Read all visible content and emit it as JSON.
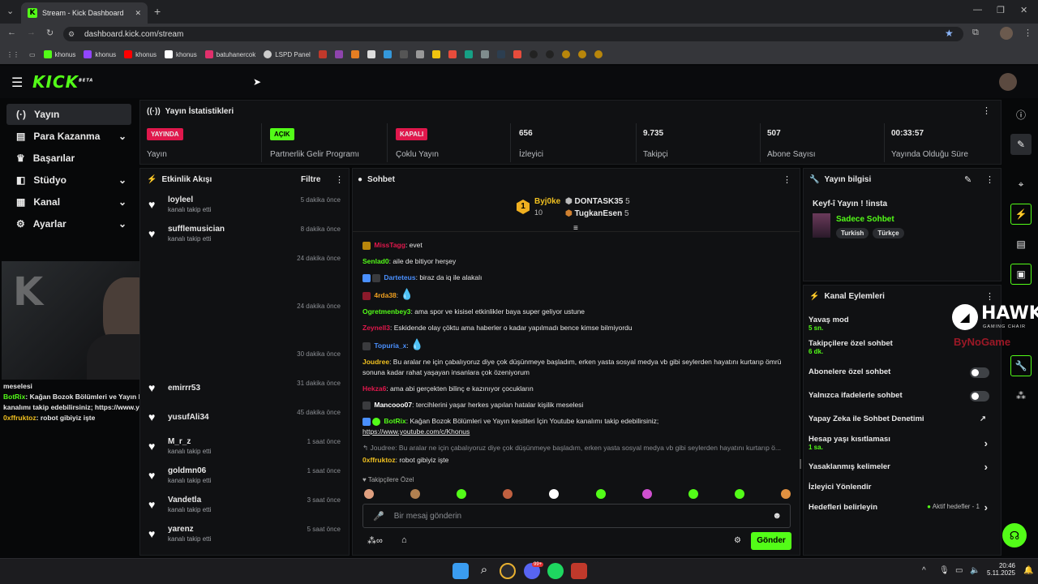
{
  "browser": {
    "tab_title": "Stream - Kick Dashboard",
    "url": "dashboard.kick.com/stream",
    "bookmarks": [
      {
        "label": "khonus",
        "color": "#53fc18"
      },
      {
        "label": "khonus",
        "color": "#9146ff"
      },
      {
        "label": "khonus",
        "color": "#ff0000"
      },
      {
        "label": "khonus",
        "color": "#ffffff"
      },
      {
        "label": "batuhanercok",
        "color": "#e1306c"
      },
      {
        "label": "LSPD Panel",
        "color": "#cccccc"
      }
    ]
  },
  "app": {
    "logo": "KICK",
    "logo_sup": "BETA"
  },
  "sidebar": {
    "items": [
      {
        "label": "Yayın",
        "icon": "broadcast-icon",
        "active": true,
        "expand": false
      },
      {
        "label": "Para Kazanma",
        "icon": "wallet-icon",
        "active": false,
        "expand": true
      },
      {
        "label": "Başarılar",
        "icon": "trophy-icon",
        "active": false,
        "expand": false
      },
      {
        "label": "Stüdyo",
        "icon": "studio-icon",
        "active": false,
        "expand": true
      },
      {
        "label": "Kanal",
        "icon": "channel-icon",
        "active": false,
        "expand": true
      },
      {
        "label": "Ayarlar",
        "icon": "gear-icon",
        "active": false,
        "expand": true
      }
    ]
  },
  "stats": {
    "title": "Yayın İstatistikleri",
    "items": [
      {
        "badge": "YAYINDA",
        "badge_color": "#e0184c",
        "label": "Yayın"
      },
      {
        "badge": "AÇIK",
        "badge_color": "#53fc18",
        "label": "Partnerlik Gelir Programı"
      },
      {
        "badge": "KAPALI",
        "badge_color": "#e0184c",
        "label": "Çoklu Yayın"
      },
      {
        "value": "656",
        "label": "İzleyici"
      },
      {
        "value": "9.735",
        "label": "Takipçi"
      },
      {
        "value": "507",
        "label": "Abone Sayısı"
      },
      {
        "value": "00:33:57",
        "label": "Yayında Olduğu Süre"
      }
    ]
  },
  "activity": {
    "title": "Etkinlik Akışı",
    "filter": "Filtre",
    "rows": [
      {
        "name": "loyleel",
        "sub": "kanalı takip etti",
        "time": "5 dakika önce"
      },
      {
        "name": "sufflemusician",
        "sub": "kanalı takip etti",
        "time": "8 dakika önce"
      },
      {
        "name": "",
        "sub": "",
        "time": "24 dakika önce"
      },
      {
        "name": "",
        "sub": "",
        "time": "24 dakika önce"
      },
      {
        "name": "",
        "sub": "",
        "time": "30 dakika önce"
      },
      {
        "name": "emirrr53",
        "sub": "",
        "time": "31 dakika önce"
      },
      {
        "name": "yusufAli34",
        "sub": "",
        "time": "45 dakika önce"
      },
      {
        "name": "M_r_z",
        "sub": "kanalı takip etti",
        "time": "1 saat önce"
      },
      {
        "name": "goldmn06",
        "sub": "kanalı takip etti",
        "time": "1 saat önce"
      },
      {
        "name": "Vandetla",
        "sub": "kanalı takip etti",
        "time": "3 saat önce"
      },
      {
        "name": "yarenz",
        "sub": "kanalı takip etti",
        "time": "5 saat önce"
      }
    ]
  },
  "overlay_chat": {
    "lines": [
      {
        "user": "",
        "text": "meselesi",
        "color": "#ffffff"
      },
      {
        "user": "BotRix",
        "text": ": Kağan Bozok Bölümleri ve Yayın kesitleri İçin Youtube kanalımı takip edebilirsiniz; https://www.youtube.com/c/Khonus",
        "color": "#53fc18"
      },
      {
        "user": "0xffruktoz",
        "text": ": robot gibiyiz işte",
        "color": "#f0c020"
      }
    ]
  },
  "chat": {
    "title": "Sohbet",
    "leaderboard": {
      "rank": "1",
      "top_user": "Byj0ke",
      "top_count": "10",
      "second_user": "DONTASK35",
      "second_count": "5",
      "third_user": "TugkanEsen",
      "third_count": "5"
    },
    "messages": [
      {
        "user": "MissTagg",
        "color": "#e0184c",
        "text": ": evet"
      },
      {
        "user": "Senlad0",
        "color": "#53fc18",
        "text": ": aile de bitiyor herşey"
      },
      {
        "user": "Darteteus",
        "color": "#4a90ff",
        "text": ": biraz da iq ile alakalı"
      },
      {
        "user": "4rda38",
        "color": "#f0a020",
        "text": ":"
      },
      {
        "user": "Ogretmenbey3",
        "color": "#53fc18",
        "text": ": ama spor ve kisisel etkinlikler baya super geliyor ustune"
      },
      {
        "user": "Zeynell3",
        "color": "#e0184c",
        "text": ": Eskidende olay çöktu ama haberler o kadar yapılmadı bence kimse bilmiyordu"
      },
      {
        "user": "Topuria_x",
        "color": "#4a90ff",
        "text": ":"
      },
      {
        "user": "Joudree",
        "color": "#f0c020",
        "text": ": Bu aralar ne için çabalıyoruz diye çok düşünmeye başladım, erken yasta sosyal medya vb gibi seylerden hayatını kurtarıp ömrü sonuna kadar rahat yaşayan insanlara çok özeniyorum"
      },
      {
        "user": "Hekza6",
        "color": "#e0184c",
        "text": ": ama abi gerçekten bilinç e kazınıyor çocukların"
      },
      {
        "user": "Mancooo07",
        "color": "#ffffff",
        "text": ": tercihlerini yaşar herkes yapılan hatalar kişilik meselesi"
      },
      {
        "user": "BotRix",
        "color": "#53fc18",
        "text": ": Kağan Bozok Bölümleri ve Yayın kesitleri İçin Youtube kanalımı takip edebilirsiniz;"
      },
      {
        "user": "",
        "color": "#ffffff",
        "text": "https://www.youtube.com/c/Khonus"
      }
    ],
    "reply_preview": "Joudree: Bu aralar ne için çabalıyoruz diye çok düşünmeye başladım, erken yasta sosyal medya vb gibi seylerden hayatını kurtarıp ö...",
    "reply_user": "0xffruktoz",
    "reply_text": ": robot gibiyiz işte",
    "followers_label": "Takipçilere Özel",
    "input_placeholder": "Bir mesaj gönderin",
    "send_label": "Gönder"
  },
  "stream_info": {
    "title": "Yayın bilgisi",
    "stream_title": "Keyf-î Yayın ! !insta",
    "category": "Sadece Sohbet",
    "tags": [
      "Turkish",
      "Türkçe"
    ]
  },
  "channel_actions": {
    "title": "Kanal Eylemleri",
    "items": [
      {
        "label": "Yavaş mod",
        "sub": "5 sn."
      },
      {
        "label": "Takipçilere özel sohbet",
        "sub": "6 dk."
      },
      {
        "label": "Abonelere özel sohbet",
        "sub": ""
      },
      {
        "label": "Yalnızca ifadelerle sohbet",
        "sub": ""
      },
      {
        "label": "Yapay Zeka ile Sohbet Denetimi",
        "sub": ""
      },
      {
        "label": "Hesap yaşı kısıtlaması",
        "sub": "1 sa."
      },
      {
        "label": "Yasaklanmış kelimeler",
        "sub": ""
      },
      {
        "label": "İzleyici Yönlendir",
        "sub": ""
      },
      {
        "label": "Hedefleri belirleyin",
        "sub": ""
      }
    ],
    "goals_status": "Aktif hedefler - 1"
  },
  "sponsor": {
    "name": "HAWK",
    "sub": "GAMING CHAIR",
    "second": "ByNoGame"
  },
  "taskbar": {
    "time": "20:46",
    "date": "5.11.2025",
    "notification_count": "99+"
  }
}
